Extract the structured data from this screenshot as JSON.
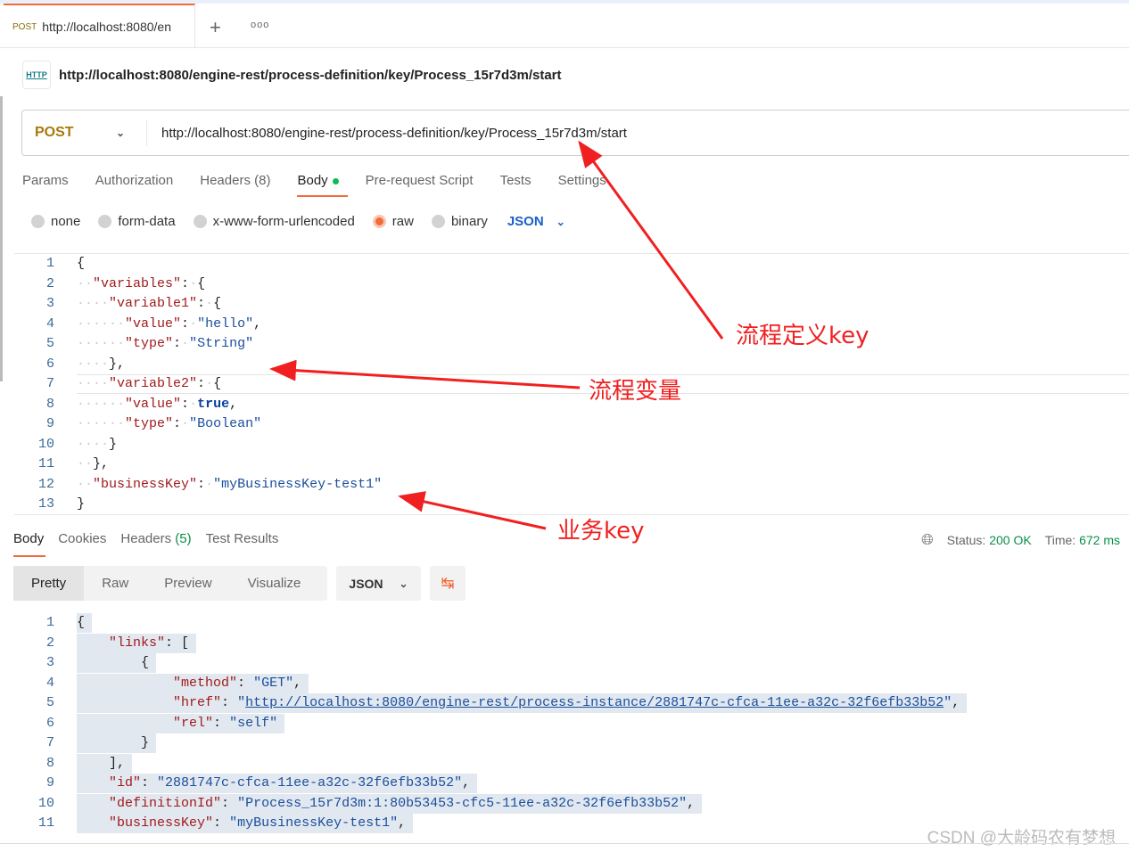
{
  "tab": {
    "method": "POST",
    "url": "http://localhost:8080/en",
    "new_tab": "+",
    "more": "ooo"
  },
  "request": {
    "icon": "http-icon",
    "icon_label": "HTTP",
    "title": "http://localhost:8080/engine-rest/process-definition/key/Process_15r7d3m/start",
    "method": "POST",
    "url": "http://localhost:8080/engine-rest/process-definition/key/Process_15r7d3m/start",
    "tabs": {
      "params": "Params",
      "authorization": "Authorization",
      "headers": "Headers",
      "headers_count": "(8)",
      "body": "Body",
      "prerequest": "Pre-request Script",
      "tests": "Tests",
      "settings": "Settings"
    },
    "body_types": [
      "none",
      "form-data",
      "x-www-form-urlencoded",
      "raw",
      "binary"
    ],
    "selected_body_type": "raw",
    "language": "JSON",
    "code_lines": [
      [
        [
          "p",
          "{"
        ]
      ],
      [
        [
          "ws",
          "··"
        ],
        [
          "k",
          "\"variables\""
        ],
        [
          "p",
          ":"
        ],
        [
          "ws",
          "·"
        ],
        [
          "p",
          "{"
        ]
      ],
      [
        [
          "ws",
          "····"
        ],
        [
          "k",
          "\"variable1\""
        ],
        [
          "p",
          ":"
        ],
        [
          "ws",
          "·"
        ],
        [
          "p",
          "{"
        ]
      ],
      [
        [
          "ws",
          "······"
        ],
        [
          "k",
          "\"value\""
        ],
        [
          "p",
          ":"
        ],
        [
          "ws",
          "·"
        ],
        [
          "s",
          "\"hello\""
        ],
        [
          "p",
          ","
        ]
      ],
      [
        [
          "ws",
          "······"
        ],
        [
          "k",
          "\"type\""
        ],
        [
          "p",
          ":"
        ],
        [
          "ws",
          "·"
        ],
        [
          "s",
          "\"String\""
        ]
      ],
      [
        [
          "ws",
          "····"
        ],
        [
          "p",
          "},"
        ]
      ],
      [
        [
          "ws",
          "····"
        ],
        [
          "k",
          "\"variable2\""
        ],
        [
          "p",
          ":"
        ],
        [
          "ws",
          "·"
        ],
        [
          "p",
          "{"
        ]
      ],
      [
        [
          "ws",
          "······"
        ],
        [
          "k",
          "\"value\""
        ],
        [
          "p",
          ":"
        ],
        [
          "ws",
          "·"
        ],
        [
          "b",
          "true"
        ],
        [
          "p",
          ","
        ]
      ],
      [
        [
          "ws",
          "······"
        ],
        [
          "k",
          "\"type\""
        ],
        [
          "p",
          ":"
        ],
        [
          "ws",
          "·"
        ],
        [
          "s",
          "\"Boolean\""
        ]
      ],
      [
        [
          "ws",
          "····"
        ],
        [
          "p",
          "}"
        ]
      ],
      [
        [
          "ws",
          "··"
        ],
        [
          "p",
          "},"
        ]
      ],
      [
        [
          "ws",
          "··"
        ],
        [
          "k",
          "\"businessKey\""
        ],
        [
          "p",
          ":"
        ],
        [
          "ws",
          "·"
        ],
        [
          "s",
          "\"myBusinessKey-test1\""
        ]
      ],
      [
        [
          "p",
          "}"
        ]
      ]
    ]
  },
  "response": {
    "tabs": {
      "body": "Body",
      "cookies": "Cookies",
      "headers": "Headers",
      "headers_count": "(5)",
      "test_results": "Test Results"
    },
    "status_label": "Status:",
    "status": "200 OK",
    "time_label": "Time:",
    "time": "672 ms",
    "views": [
      "Pretty",
      "Raw",
      "Preview",
      "Visualize"
    ],
    "selected_view": "Pretty",
    "format": "JSON",
    "code_lines": [
      [
        [
          "p",
          "{"
        ]
      ],
      [
        [
          "p",
          "    "
        ],
        [
          "k",
          "\"links\""
        ],
        [
          "p",
          ": ["
        ]
      ],
      [
        [
          "p",
          "        {"
        ]
      ],
      [
        [
          "p",
          "            "
        ],
        [
          "k",
          "\"method\""
        ],
        [
          "p",
          ": "
        ],
        [
          "s",
          "\"GET\""
        ],
        [
          "p",
          ","
        ]
      ],
      [
        [
          "p",
          "            "
        ],
        [
          "k",
          "\"href\""
        ],
        [
          "p",
          ": "
        ],
        [
          "s",
          "\""
        ],
        [
          "link",
          "http://localhost:8080/engine-rest/process-instance/2881747c-cfca-11ee-a32c-32f6efb33b52"
        ],
        [
          "s",
          "\""
        ],
        [
          "p",
          ","
        ]
      ],
      [
        [
          "p",
          "            "
        ],
        [
          "k",
          "\"rel\""
        ],
        [
          "p",
          ": "
        ],
        [
          "s",
          "\"self\""
        ]
      ],
      [
        [
          "p",
          "        }"
        ]
      ],
      [
        [
          "p",
          "    ],"
        ]
      ],
      [
        [
          "p",
          "    "
        ],
        [
          "k",
          "\"id\""
        ],
        [
          "p",
          ": "
        ],
        [
          "s",
          "\"2881747c-cfca-11ee-a32c-32f6efb33b52\""
        ],
        [
          "p",
          ","
        ]
      ],
      [
        [
          "p",
          "    "
        ],
        [
          "k",
          "\"definitionId\""
        ],
        [
          "p",
          ": "
        ],
        [
          "s",
          "\"Process_15r7d3m:1:80b53453-cfc5-11ee-a32c-32f6efb33b52\""
        ],
        [
          "p",
          ","
        ]
      ],
      [
        [
          "p",
          "    "
        ],
        [
          "k",
          "\"businessKey\""
        ],
        [
          "p",
          ": "
        ],
        [
          "s",
          "\"myBusinessKey-test1\""
        ],
        [
          "p",
          ","
        ]
      ]
    ]
  },
  "annotations": {
    "definition_key": "流程定义key",
    "variables": "流程变量",
    "business_key": "业务key",
    "color": "#f02020"
  },
  "watermark": "CSDN @大龄码农有梦想"
}
